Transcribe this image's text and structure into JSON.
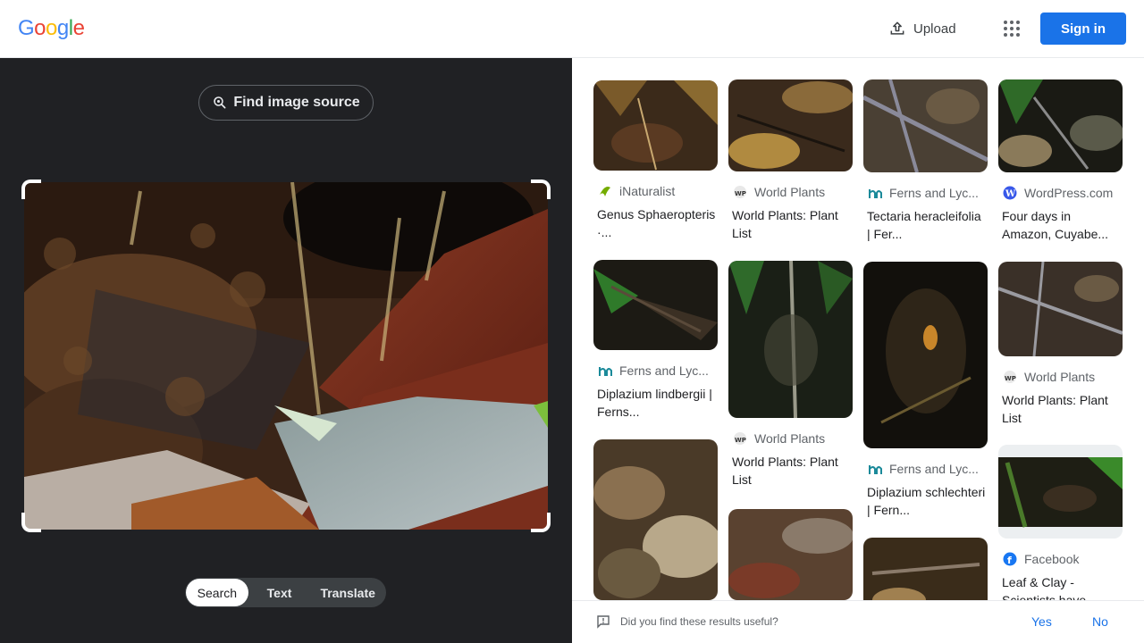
{
  "header": {
    "logo_letters": [
      "G",
      "o",
      "o",
      "g",
      "l",
      "e"
    ],
    "logo_colors": [
      "#4285f4",
      "#ea4335",
      "#fbbc05",
      "#4285f4",
      "#34a853",
      "#ea4335"
    ],
    "upload_label": "Upload",
    "signin_label": "Sign in",
    "apps_icon": "apps-grid-icon"
  },
  "left": {
    "find_source_label": "Find image source",
    "tabs": [
      {
        "label": "Search",
        "active": true
      },
      {
        "label": "Text",
        "active": false
      },
      {
        "label": "Translate",
        "active": false
      }
    ]
  },
  "results": [
    {
      "source": "iNaturalist",
      "icon": "inaturalist-icon",
      "title": "Genus Sphaeropteris · iNaturalist"
    },
    {
      "source": "World Plants",
      "icon": "world-plants-icon",
      "title": "World Plants: Plant List"
    },
    {
      "source": "Ferns and Lycophytes",
      "icon": "ferns-lycophytes-icon",
      "title": "Tectaria heracleifolia | Ferns and Lycophytes"
    },
    {
      "source": "WordPress.com",
      "icon": "wordpress-icon",
      "title": "Four days in Amazon, Cuyabeno Reserve"
    },
    {
      "source": "Ferns and Lycophytes",
      "icon": "ferns-lycophytes-icon",
      "title": "Diplazium lindbergii | Ferns and Lycophytes"
    },
    {
      "source": "World Plants",
      "icon": "world-plants-icon",
      "title": "World Plants: Plant List"
    },
    {
      "source": "Ferns and Lycophytes",
      "icon": "ferns-lycophytes-icon",
      "title": "Diplazium schlechteri | Ferns and Lycophytes"
    },
    {
      "source": "World Plants",
      "icon": "world-plants-icon",
      "title": "World Plants: Plant List"
    },
    {
      "source": "Facebook",
      "icon": "facebook-icon",
      "title": "Leaf & Clay - Scientists have discovered"
    }
  ],
  "source_display": {
    "inaturalist": "iNaturalist",
    "worldplants": "World Plants",
    "ferns": "Ferns and Lyc...",
    "wordpress": "WordPress.com",
    "facebook": "Facebook"
  },
  "titles_display": [
    "Genus Sphaeropteris ·...",
    "World Plants: Plant List",
    "Tectaria heracleifolia | Fer...",
    "Four days in Amazon, Cuyabe...",
    "Diplazium lindbergii | Ferns...",
    "World Plants: Plant List",
    "Diplazium schlechteri | Fern...",
    "World Plants: Plant List",
    "Leaf & Clay - Scientists have..."
  ],
  "feedback": {
    "question": "Did you find these results useful?",
    "yes": "Yes",
    "no": "No"
  },
  "colors": {
    "primary_blue": "#1a73e8",
    "dark_panel": "#202124"
  }
}
